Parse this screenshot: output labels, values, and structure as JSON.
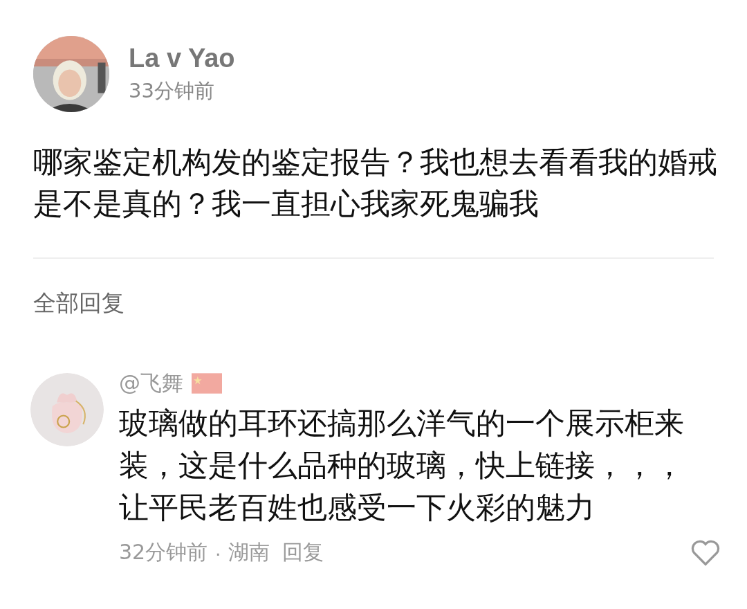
{
  "post": {
    "author": "La v Yao",
    "time": "33分钟前",
    "text": "哪家鉴定机构发的鉴定报告？我也想去看看我的婚戒是不是真的？我一直担心我家死鬼骗我"
  },
  "replies_header": "全部回复",
  "replies": [
    {
      "author": "@飞舞",
      "text": "玻璃做的耳环还搞那么洋气的一个展示柜来装，这是什么品种的玻璃，快上链接，，，让平民老百姓也感受一下火彩的魅力",
      "time": "32分钟前",
      "separator": "·",
      "location": "湖南",
      "reply_label": "回复"
    }
  ]
}
